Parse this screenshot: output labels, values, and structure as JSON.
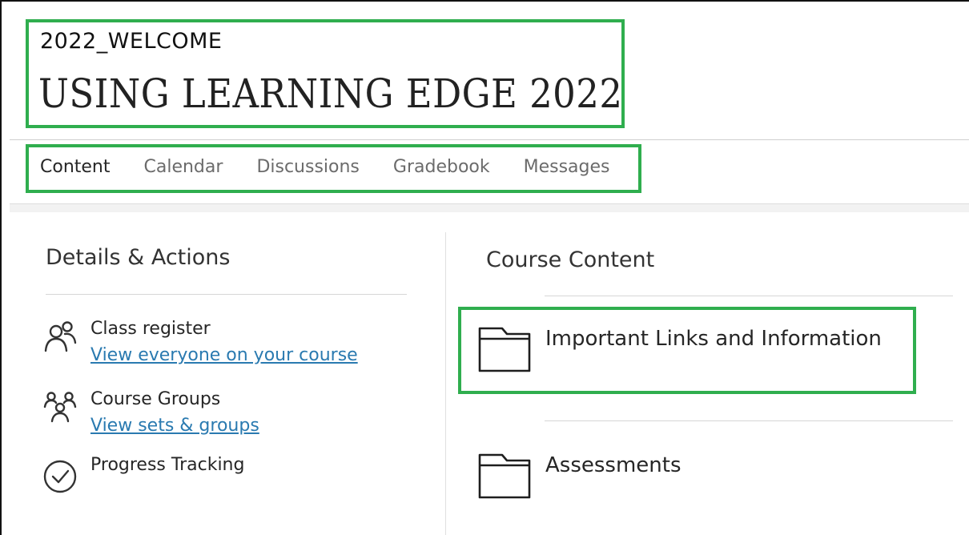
{
  "course": {
    "code": "2022_WELCOME",
    "title": "USING LEARNING EDGE 2022"
  },
  "tabs": [
    {
      "label": "Content",
      "active": true
    },
    {
      "label": "Calendar",
      "active": false
    },
    {
      "label": "Discussions",
      "active": false
    },
    {
      "label": "Gradebook",
      "active": false
    },
    {
      "label": "Messages",
      "active": false
    }
  ],
  "details": {
    "title": "Details & Actions",
    "items": [
      {
        "label": "Class register",
        "link": "View everyone on your course",
        "icon": "people-icon"
      },
      {
        "label": "Course Groups",
        "link": "View sets & groups",
        "icon": "groups-icon"
      },
      {
        "label": "Progress Tracking",
        "icon": "check-circle-icon"
      }
    ]
  },
  "course_content": {
    "title": "Course Content",
    "items": [
      {
        "label": "Important Links and Information",
        "icon": "folder-icon"
      },
      {
        "label": "Assessments",
        "icon": "folder-icon"
      }
    ]
  },
  "colors": {
    "highlight": "#2fae4e",
    "link": "#2a7ab0",
    "text": "#262626",
    "tab_inactive": "#6b6b6b"
  }
}
